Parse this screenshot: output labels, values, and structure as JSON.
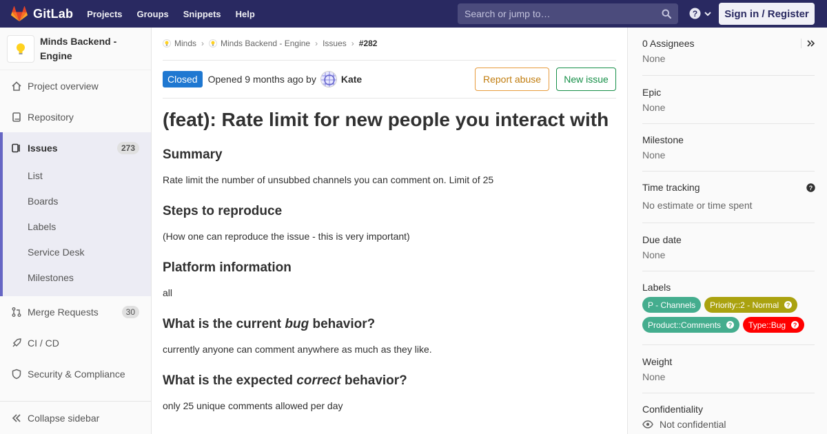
{
  "topnav": {
    "brand": "GitLab",
    "links": [
      "Projects",
      "Groups",
      "Snippets",
      "Help"
    ],
    "search_placeholder": "Search or jump to…",
    "signin_label": "Sign in / Register"
  },
  "sidebar": {
    "project_name": "Minds Backend - Engine",
    "items": {
      "overview": "Project overview",
      "repository": "Repository",
      "issues": "Issues",
      "issues_count": "273",
      "merge_requests": "Merge Requests",
      "mr_count": "30",
      "cicd": "CI / CD",
      "security": "Security & Compliance"
    },
    "sub_items": [
      "List",
      "Boards",
      "Labels",
      "Service Desk",
      "Milestones"
    ],
    "collapse_label": "Collapse sidebar"
  },
  "breadcrumbs": {
    "group": "Minds",
    "project": "Minds Backend - Engine",
    "section": "Issues",
    "issue": "#282"
  },
  "issue": {
    "status": "Closed",
    "opened_text": "Opened 9 months ago by",
    "author": "Kate",
    "report_abuse": "Report abuse",
    "new_issue": "New issue",
    "title": "(feat): Rate limit for new people you interact with",
    "sections": {
      "summary_h": "Summary",
      "summary_p": "Rate limit the number of unsubbed channels you can comment on. Limit of 25",
      "steps_h": "Steps to reproduce",
      "steps_p": "(How one can reproduce the issue - this is very important)",
      "platform_h": "Platform information",
      "platform_p": "all",
      "current_h_pre": "What is the current ",
      "current_h_em": "bug",
      "current_h_post": " behavior?",
      "current_p": "currently anyone can comment anywhere as much as they like.",
      "expected_h_pre": "What is the expected ",
      "expected_h_em": "correct",
      "expected_h_post": " behavior?",
      "expected_p": "only 25 unique comments allowed per day"
    }
  },
  "right_sidebar": {
    "assignees_title": "0 Assignees",
    "assignees_val": "None",
    "epic_title": "Epic",
    "epic_val": "None",
    "milestone_title": "Milestone",
    "milestone_val": "None",
    "time_title": "Time tracking",
    "time_val": "No estimate or time spent",
    "due_title": "Due date",
    "due_val": "None",
    "labels_title": "Labels",
    "labels": [
      {
        "text": "P - Channels",
        "color": "#44ad8e"
      },
      {
        "text": "Priority::2 - Normal",
        "color": "#aaa20f"
      },
      {
        "text": "Product::Comments",
        "color": "#44ad8e"
      },
      {
        "text": "Type::Bug",
        "color": "#ff0000"
      }
    ],
    "weight_title": "Weight",
    "weight_val": "None",
    "conf_title": "Confidentiality",
    "conf_val": "Not confidential"
  }
}
